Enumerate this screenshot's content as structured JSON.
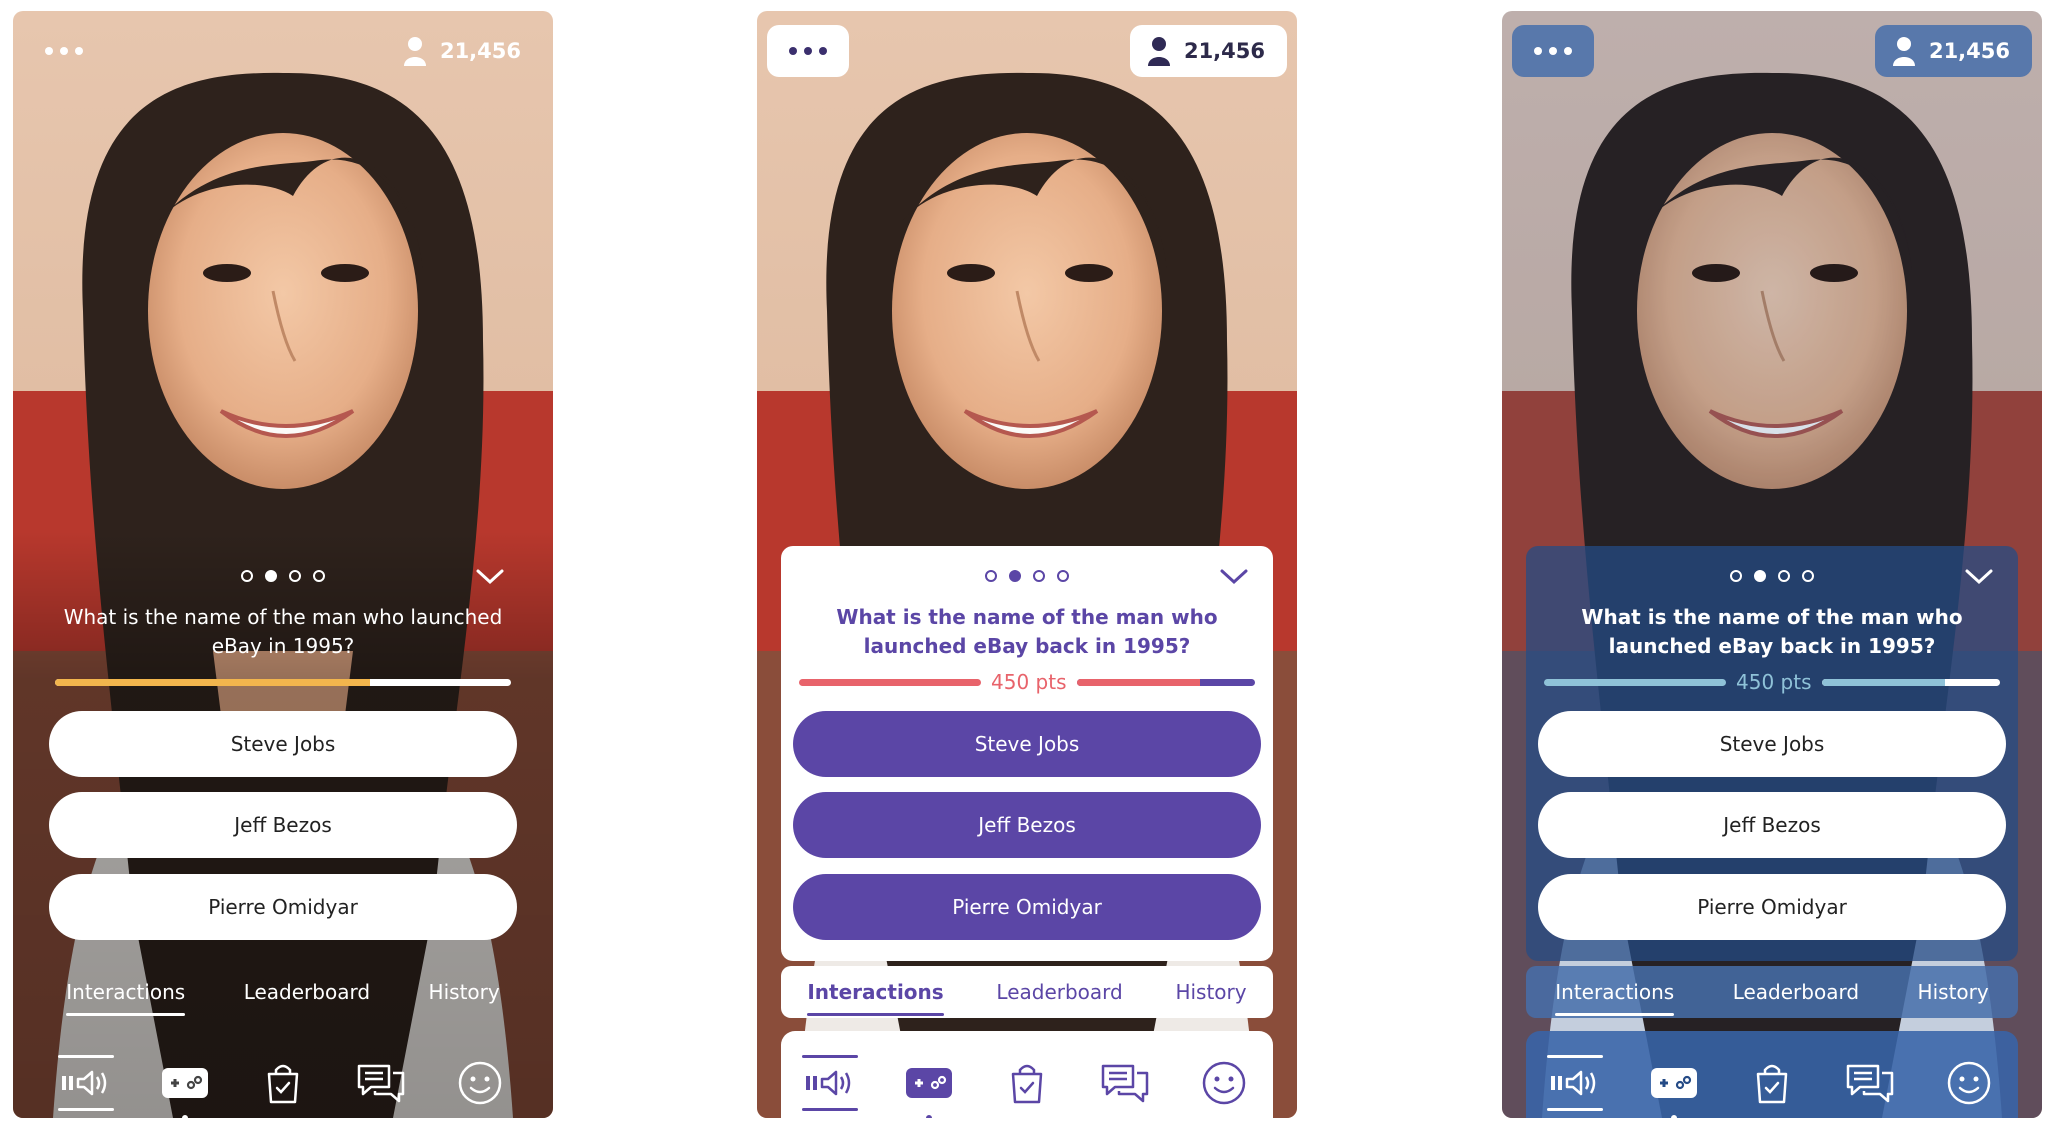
{
  "viewer_count": "21,456",
  "poll": {
    "question_short": "What is the name of the man who launched eBay in 1995?",
    "question_long": "What is the name of the man who launched eBay back in 1995?",
    "points": "450 pts",
    "answers": [
      "Steve Jobs",
      "Jeff Bezos",
      "Pierre Omidyar"
    ],
    "page_indicator": {
      "total": 4,
      "current": 2
    },
    "timer_progress": 0.69
  },
  "tabs": [
    {
      "label": "Interactions",
      "active": true
    },
    {
      "label": "Leaderboard",
      "active": false
    },
    {
      "label": "History",
      "active": false
    }
  ],
  "bottom_bar": [
    {
      "icon": "pause-volume-icon"
    },
    {
      "icon": "gamepad-icon",
      "selected": true
    },
    {
      "icon": "shopping-bag-icon"
    },
    {
      "icon": "chat-icon"
    },
    {
      "icon": "smiley-icon"
    }
  ],
  "themes": {
    "transparent": {
      "accent": "#F2B54D",
      "button_bg": "#FFFFFF",
      "button_text": "#222222",
      "text": "#FFFFFF"
    },
    "light": {
      "accent": "#5B46A6",
      "timer": "#E8636B",
      "panel": "#FFFFFF"
    },
    "blue": {
      "accent": "#254B86",
      "timer": "#8FC2D8",
      "panel": "rgba(37,75,134,0.72)"
    }
  }
}
